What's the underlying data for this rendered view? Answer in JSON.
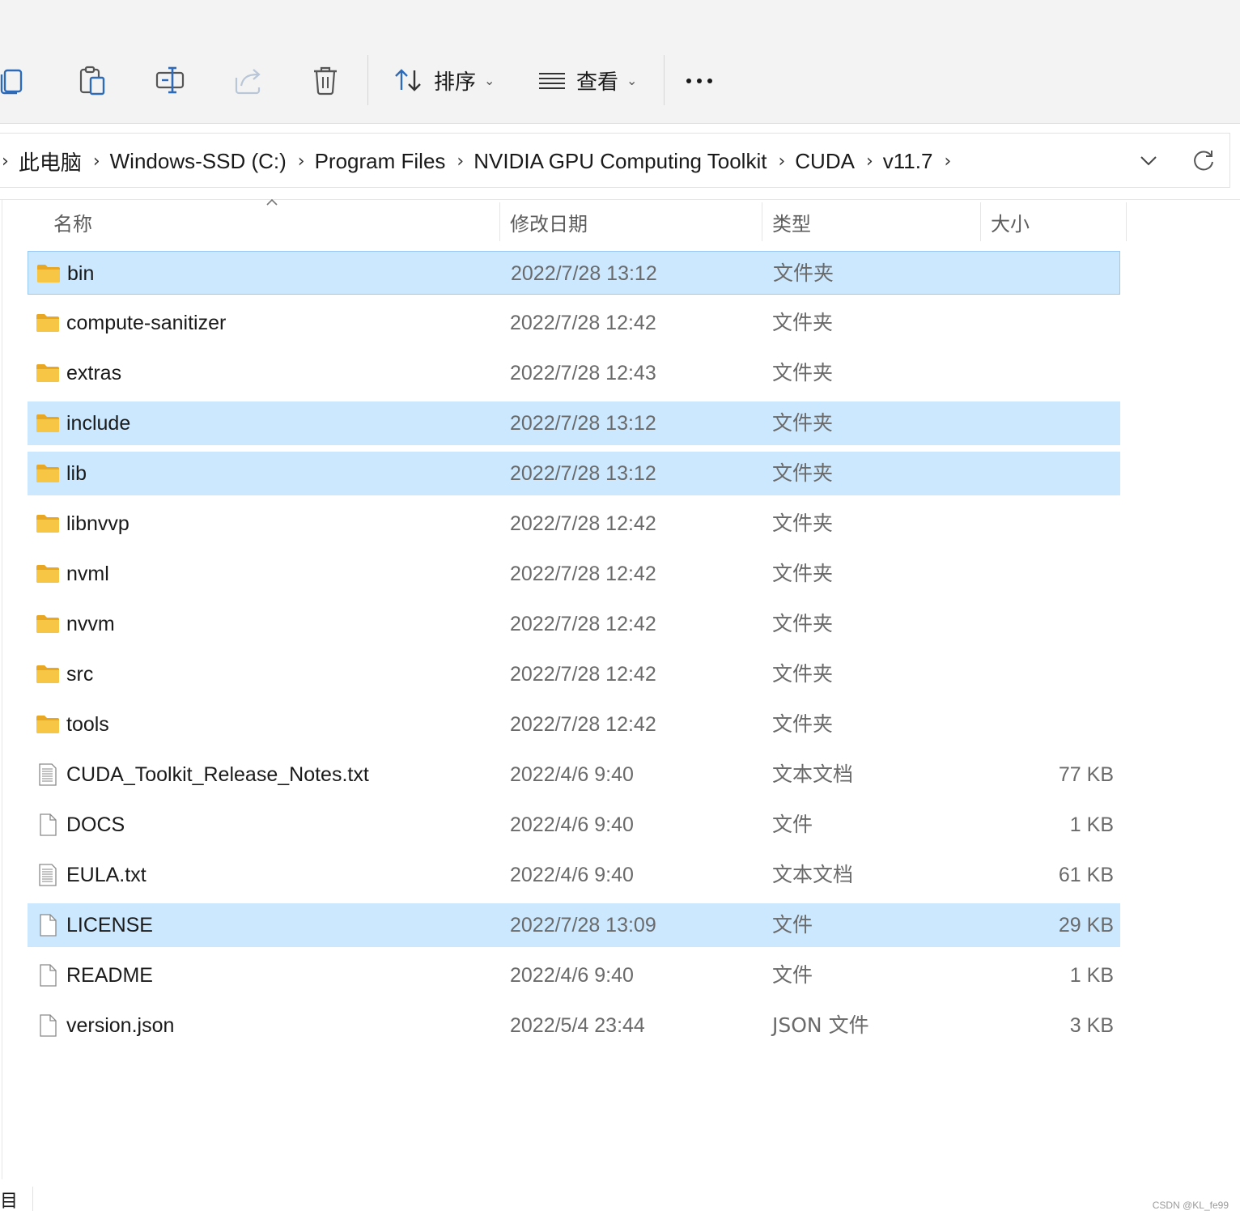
{
  "toolbar": {
    "sort_label": "排序",
    "view_label": "查看",
    "icons": [
      "copy-icon",
      "paste-icon",
      "rename-icon",
      "share-icon",
      "delete-icon",
      "sort-icon",
      "view-icon",
      "more-icon"
    ]
  },
  "address": {
    "crumbs": [
      "此电脑",
      "Windows-SSD (C:)",
      "Program Files",
      "NVIDIA GPU Computing Toolkit",
      "CUDA",
      "v11.7"
    ]
  },
  "columns": {
    "name": "名称",
    "date": "修改日期",
    "type": "类型",
    "size": "大小"
  },
  "files": [
    {
      "name": "bin",
      "date": "2022/7/28 13:12",
      "type": "文件夹",
      "size": "",
      "kind": "folder",
      "selected": true
    },
    {
      "name": "compute-sanitizer",
      "date": "2022/7/28 12:42",
      "type": "文件夹",
      "size": "",
      "kind": "folder",
      "selected": false
    },
    {
      "name": "extras",
      "date": "2022/7/28 12:43",
      "type": "文件夹",
      "size": "",
      "kind": "folder",
      "selected": false
    },
    {
      "name": "include",
      "date": "2022/7/28 13:12",
      "type": "文件夹",
      "size": "",
      "kind": "folder",
      "selected": true
    },
    {
      "name": "lib",
      "date": "2022/7/28 13:12",
      "type": "文件夹",
      "size": "",
      "kind": "folder",
      "selected": true
    },
    {
      "name": "libnvvp",
      "date": "2022/7/28 12:42",
      "type": "文件夹",
      "size": "",
      "kind": "folder",
      "selected": false
    },
    {
      "name": "nvml",
      "date": "2022/7/28 12:42",
      "type": "文件夹",
      "size": "",
      "kind": "folder",
      "selected": false
    },
    {
      "name": "nvvm",
      "date": "2022/7/28 12:42",
      "type": "文件夹",
      "size": "",
      "kind": "folder",
      "selected": false
    },
    {
      "name": "src",
      "date": "2022/7/28 12:42",
      "type": "文件夹",
      "size": "",
      "kind": "folder",
      "selected": false
    },
    {
      "name": "tools",
      "date": "2022/7/28 12:42",
      "type": "文件夹",
      "size": "",
      "kind": "folder",
      "selected": false
    },
    {
      "name": "CUDA_Toolkit_Release_Notes.txt",
      "date": "2022/4/6 9:40",
      "type": "文本文档",
      "size": "77 KB",
      "kind": "text",
      "selected": false
    },
    {
      "name": "DOCS",
      "date": "2022/4/6 9:40",
      "type": "文件",
      "size": "1 KB",
      "kind": "file",
      "selected": false
    },
    {
      "name": "EULA.txt",
      "date": "2022/4/6 9:40",
      "type": "文本文档",
      "size": "61 KB",
      "kind": "text",
      "selected": false
    },
    {
      "name": "LICENSE",
      "date": "2022/7/28 13:09",
      "type": "文件",
      "size": "29 KB",
      "kind": "file",
      "selected": true
    },
    {
      "name": "README",
      "date": "2022/4/6 9:40",
      "type": "文件",
      "size": "1 KB",
      "kind": "file",
      "selected": false
    },
    {
      "name": "version.json",
      "date": "2022/5/4 23:44",
      "type": "JSON 文件",
      "size": "3 KB",
      "kind": "file",
      "selected": false
    }
  ],
  "status": {
    "fragment": "目"
  },
  "watermark": "CSDN @KL_fe99",
  "colors": {
    "selection": "#cce8ff",
    "selection_border": "#99c9f4",
    "folder": "#f6c644",
    "toolbar_bg": "#f3f3f3",
    "accent": "#2d6bb8"
  }
}
